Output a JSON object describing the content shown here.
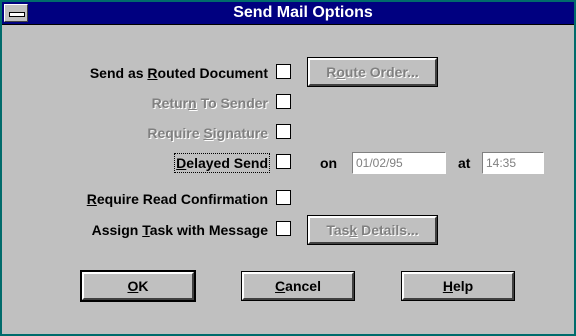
{
  "window": {
    "title": "Send Mail Options"
  },
  "options": [
    {
      "pre": "Send as ",
      "ul": "R",
      "post": "outed Document",
      "enabled": true
    },
    {
      "pre": "Retur",
      "ul": "n",
      "post": " To Sender",
      "enabled": false
    },
    {
      "pre": "Require ",
      "ul": "S",
      "post": "ignature",
      "enabled": false
    },
    {
      "pre": "",
      "ul": "D",
      "post": "elayed Send",
      "enabled": true
    },
    {
      "pre": "",
      "ul": "R",
      "post": "equire Read Confirmation",
      "enabled": true
    },
    {
      "pre": "Assign ",
      "ul": "T",
      "post": "ask with Message",
      "enabled": true
    }
  ],
  "route_order_button": {
    "pre": "R",
    "ul": "o",
    "post": "ute Order...",
    "enabled": false
  },
  "task_details_button": {
    "pre": "Tas",
    "ul": "k",
    "post": " Details...",
    "enabled": false
  },
  "delayed": {
    "on_label": "on",
    "date": "01/02/95",
    "at_label": "at",
    "time": "14:35"
  },
  "footer_buttons": [
    {
      "pre": "",
      "ul": "O",
      "post": "K"
    },
    {
      "pre": "",
      "ul": "C",
      "post": "ancel"
    },
    {
      "pre": "",
      "ul": "H",
      "post": "elp"
    }
  ],
  "colors": {
    "title_bar": "#000080",
    "window_border": "#006b6b",
    "face": "#c0c0c0",
    "disabled_text": "#808080"
  }
}
